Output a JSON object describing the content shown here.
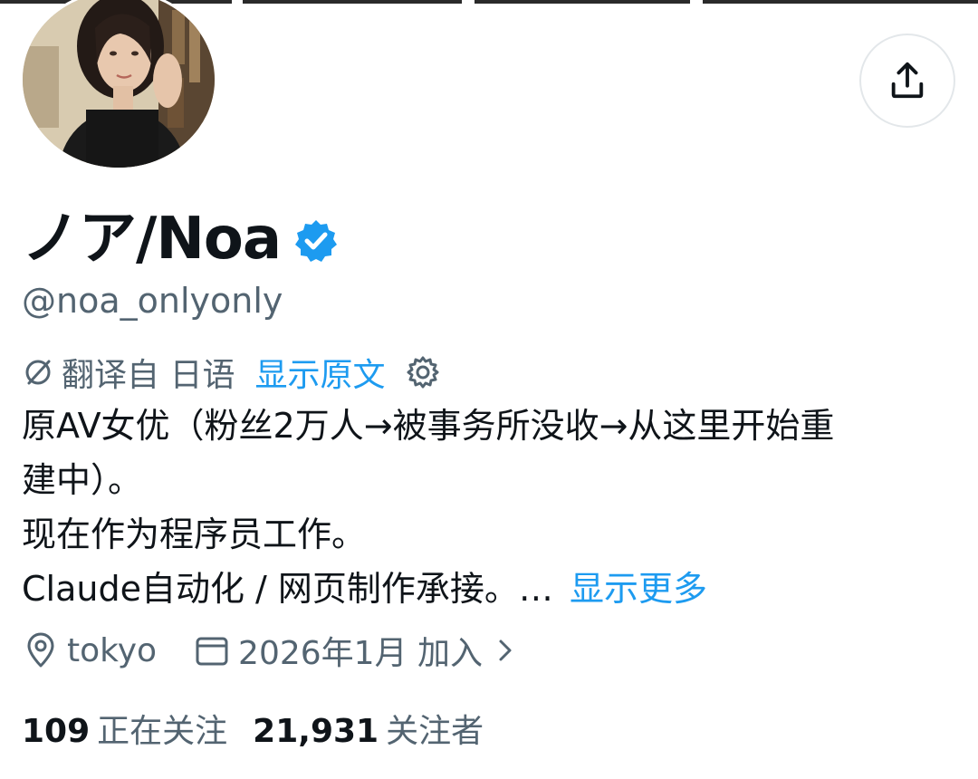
{
  "profile": {
    "display_name": "ノア/Noa",
    "handle": "@noa_onlyonly",
    "verified": true,
    "verified_icon": "verified-badge-icon",
    "avatar_icon": "avatar-photo"
  },
  "translation": {
    "label": "翻译自 日语",
    "show_original": "显示原文"
  },
  "bio": {
    "lines": [
      "原AV女优（粉丝2万人→被事务所没收→从这里开始重",
      "建中）。",
      "现在作为程序员工作。",
      "Claude自动化 / 网页制作承接。…"
    ],
    "show_more": "显示更多"
  },
  "meta": {
    "location": "tokyo",
    "joined": "2026年1月 加入"
  },
  "stats": {
    "following_count": "109",
    "following_label": "正在关注",
    "followers_count": "21,931",
    "followers_label": "关注者"
  },
  "colors": {
    "link": "#1d9bf0",
    "secondary_text": "#536471",
    "primary_text": "#0f1419",
    "verified": "#1d9bf0"
  }
}
